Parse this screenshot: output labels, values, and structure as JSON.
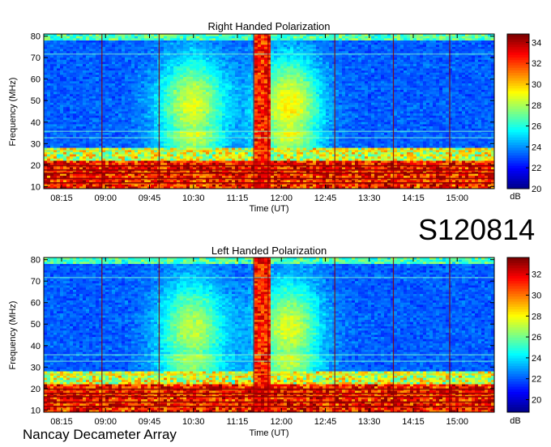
{
  "station_code": "S120814",
  "instrument": "Nancay Decameter Array",
  "chart_data": [
    {
      "type": "heatmap",
      "title": "Right Handed Polarization",
      "xlabel": "Time (UT)",
      "ylabel": "Frequency (MHz)",
      "x_ticks": [
        "08:15",
        "09:00",
        "09:45",
        "10:30",
        "11:15",
        "12:00",
        "12:45",
        "13:30",
        "14:15",
        "15:00"
      ],
      "y_ticks": [
        10,
        20,
        30,
        40,
        50,
        60,
        70,
        80
      ],
      "ylim": [
        9,
        81
      ],
      "colorbar": {
        "label": "dB",
        "ticks": [
          20,
          22,
          24,
          26,
          28,
          30,
          32,
          34
        ],
        "range": [
          20,
          34.8
        ]
      },
      "colormap": [
        "#00008f",
        "#0000ff",
        "#0080ff",
        "#00ffff",
        "#80ff80",
        "#ffff00",
        "#ff8000",
        "#ff0000",
        "#800000"
      ]
    },
    {
      "type": "heatmap",
      "title": "Left Handed Polarization",
      "xlabel": "Time (UT)",
      "ylabel": "Frequency (MHz)",
      "x_ticks": [
        "08:15",
        "09:00",
        "09:45",
        "10:30",
        "11:15",
        "12:00",
        "12:45",
        "13:30",
        "14:15",
        "15:00"
      ],
      "y_ticks": [
        10,
        20,
        30,
        40,
        50,
        60,
        70,
        80
      ],
      "ylim": [
        9,
        81
      ],
      "colorbar": {
        "label": "dB",
        "ticks": [
          20,
          22,
          24,
          26,
          28,
          30,
          32
        ],
        "range": [
          18.8,
          33.6
        ]
      },
      "colormap": [
        "#00008f",
        "#0000ff",
        "#0080ff",
        "#00ffff",
        "#80ff80",
        "#ffff00",
        "#ff8000",
        "#ff0000",
        "#800000"
      ]
    }
  ]
}
